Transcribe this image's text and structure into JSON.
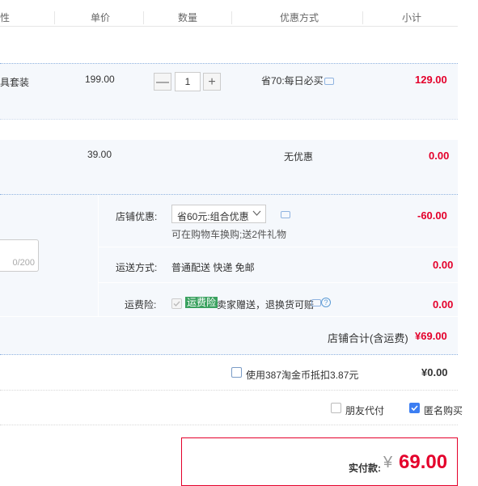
{
  "header": {
    "col_name": "性",
    "col_price": "单价",
    "col_qty": "数量",
    "col_promo": "优惠方式",
    "col_subtotal": "小计"
  },
  "items": [
    {
      "name": "具套装",
      "price": "199.00",
      "qty": "1",
      "minus": "—",
      "plus": "+",
      "promo": "省70:每日必买",
      "subtotal": "129.00"
    },
    {
      "price": "39.00",
      "promo": "无优惠",
      "subtotal": "0.00"
    }
  ],
  "shop": {
    "discount_label": "店铺优惠:",
    "discount_select": "省60元:组合优惠",
    "discount_note": "可在购物车换购;送2件礼物",
    "discount_value": "-60.00",
    "message_counter": "0/200",
    "shipping_label": "运送方式:",
    "shipping_value": "普通配送 快递 免邮",
    "shipping_price": "0.00",
    "insurance_label": "运费险:",
    "insurance_badge": "运费险",
    "insurance_text": "卖家赠送，退换货可赔",
    "insurance_price": "0.00",
    "total_label": "店铺合计(含运费)",
    "total_value": "¥69.00"
  },
  "coins": {
    "label": "使用387淘金币抵扣3.87元",
    "value": "¥0.00"
  },
  "options": {
    "friend_pay": "朋友代付",
    "anonymous": "匿名购买"
  },
  "pay": {
    "label": "实付款:",
    "currency": "¥",
    "amount": "69.00"
  },
  "colors": {
    "accent_red": "#e4002b",
    "checkbox_blue": "#3c7ef2",
    "badge_green": "#3aa15f"
  }
}
